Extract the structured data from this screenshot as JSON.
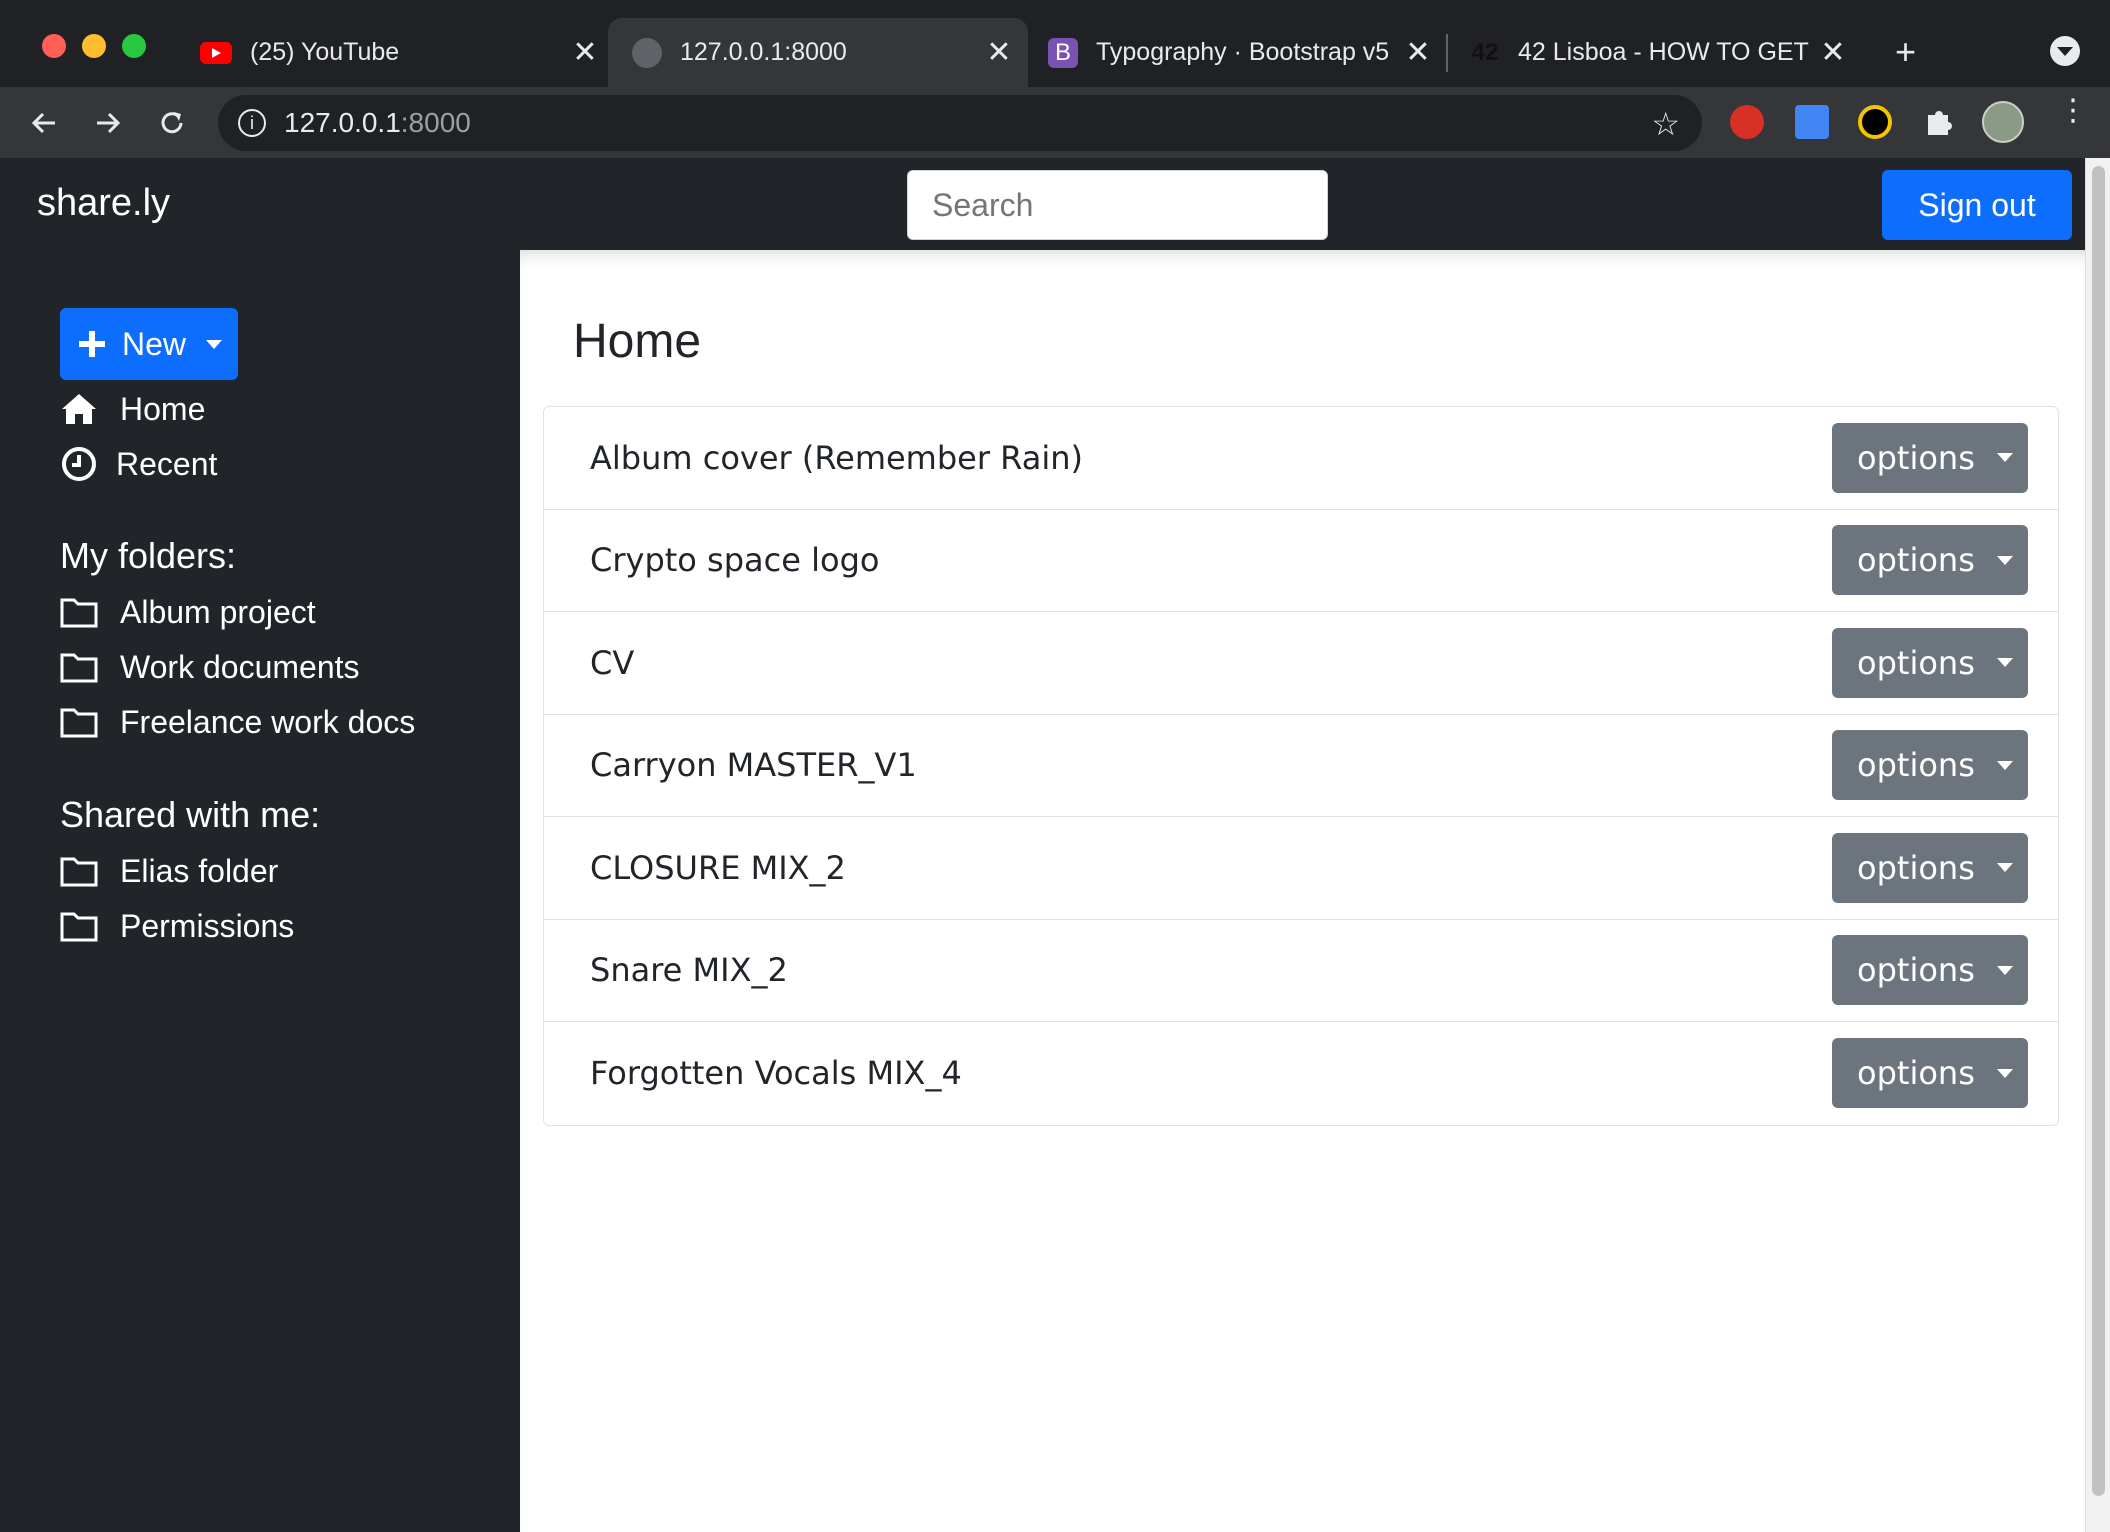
{
  "browser": {
    "tabs": [
      {
        "title": "(25) YouTube",
        "favicon": "youtube-icon"
      },
      {
        "title": "127.0.0.1:8000",
        "favicon": "globe-icon"
      },
      {
        "title": "Typography · Bootstrap v5",
        "favicon": "bootstrap-icon"
      },
      {
        "title": "42 Lisboa - HOW TO GET",
        "favicon": "42-icon"
      }
    ],
    "bootstrap_letter": "B",
    "fortytwo_text": "42",
    "url_host": "127.0.0.1",
    "url_port": ":8000"
  },
  "app": {
    "brand": "share.ly",
    "search_placeholder": "Search",
    "signout_label": "Sign out"
  },
  "sidebar": {
    "new_label": "New",
    "nav": [
      {
        "label": "Home",
        "icon": "home-icon"
      },
      {
        "label": "Recent",
        "icon": "clock-icon"
      }
    ],
    "folders_heading": "My folders:",
    "folders": [
      "Album project",
      "Work documents",
      "Freelance work docs"
    ],
    "shared_heading": "Shared with me:",
    "shared": [
      "Elias folder",
      "Permissions"
    ]
  },
  "main": {
    "title": "Home",
    "option_label": "options",
    "items": [
      "Album cover (Remember Rain)",
      "Crypto space logo",
      "CV",
      "Carryon MASTER_V1",
      "CLOSURE MIX_2",
      "Snare MIX_2",
      "Forgotten Vocals MIX_4"
    ]
  },
  "colors": {
    "primary": "#0d6efd",
    "secondary": "#6c757d",
    "dark": "#212529"
  }
}
